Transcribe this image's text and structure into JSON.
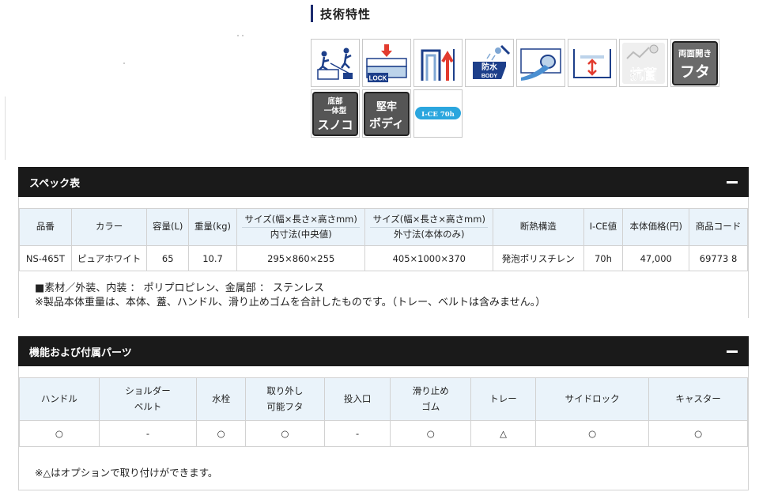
{
  "tech": {
    "title": "技術特性",
    "badges": {
      "lock": "LOCK",
      "body_top": "防水",
      "body_bottom": "BODY",
      "kokin": "抗菌",
      "futa_top": "両面開き",
      "futa_bottom": "フタ",
      "sunoko_1": "底部",
      "sunoko_2": "一体型",
      "sunoko_3": "スノコ",
      "body2_1": "堅牢",
      "body2_2": "ボディ",
      "ice": "I-CE 70h"
    }
  },
  "spec": {
    "title": "スペック表",
    "headers": [
      "品番",
      "カラー",
      "容量(L)",
      "重量(kg)",
      "サイズ(幅×長さ×高さmm)",
      "内寸法(中央値)",
      "サイズ(幅×長さ×高さmm)",
      "外寸法(本体のみ)",
      "断熱構造",
      "I-CE値",
      "本体価格(円)",
      "商品コード"
    ],
    "row": [
      "NS-465T",
      "ピュアホワイト",
      "65",
      "10.7",
      "295×860×255",
      "405×1000×370",
      "発泡ポリスチレン",
      "70h",
      "47,000",
      "69773 8"
    ],
    "note1": "■素材／外装、内装 ： ポリプロピレン、金属部 ： ステンレス",
    "note2": "※製品本体重量は、本体、蓋、ハンドル、滑り止めゴムを合計したものです。（トレー、ベルトは含みません。）"
  },
  "parts": {
    "title": "機能および付属パーツ",
    "headers": [
      {
        "l1": "ハンドル",
        "l2": ""
      },
      {
        "l1": "ショルダー",
        "l2": "ベルト"
      },
      {
        "l1": "水栓",
        "l2": ""
      },
      {
        "l1": "取り外し",
        "l2": "可能フタ"
      },
      {
        "l1": "投入口",
        "l2": ""
      },
      {
        "l1": "滑り止め",
        "l2": "ゴム"
      },
      {
        "l1": "トレー",
        "l2": ""
      },
      {
        "l1": "サイドロック",
        "l2": ""
      },
      {
        "l1": "キャスター",
        "l2": ""
      }
    ],
    "values": [
      "○",
      "-",
      "○",
      "○",
      "-",
      "○",
      "△",
      "○",
      "○"
    ],
    "footnote": "※△はオプションで取り付けができます。"
  }
}
